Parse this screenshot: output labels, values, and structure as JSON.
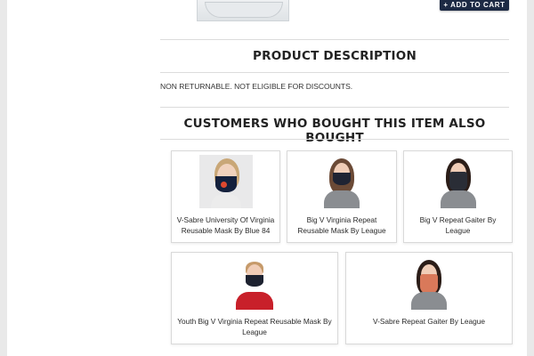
{
  "header": {
    "add_to_cart_label": "+ ADD TO CART"
  },
  "description": {
    "title": "PRODUCT DESCRIPTION",
    "text": "NON RETURNABLE. NOT ELIGIBLE FOR DISCOUNTS."
  },
  "related": {
    "title": "CUSTOMERS WHO BOUGHT THIS ITEM ALSO BOUGHT",
    "items": [
      {
        "name": "V-Sabre University Of Virginia Reusable Mask By Blue 84",
        "mask_color": "#15213d"
      },
      {
        "name": "Big V Virginia Repeat Reusable Mask By League",
        "mask_color": "#1f2433"
      },
      {
        "name": "Big V Repeat Gaiter By League",
        "mask_color": "#2a2d36"
      },
      {
        "name": "Youth Big V Virginia Repeat Reusable Mask By League",
        "mask_color": "#1d2230"
      },
      {
        "name": "V-Sabre Repeat Gaiter By League",
        "mask_color": "#d9795a"
      }
    ]
  },
  "colors": {
    "button": "#1d2a44",
    "shirt_gray": "#8a8d91",
    "shirt_red": "#c8202a"
  }
}
